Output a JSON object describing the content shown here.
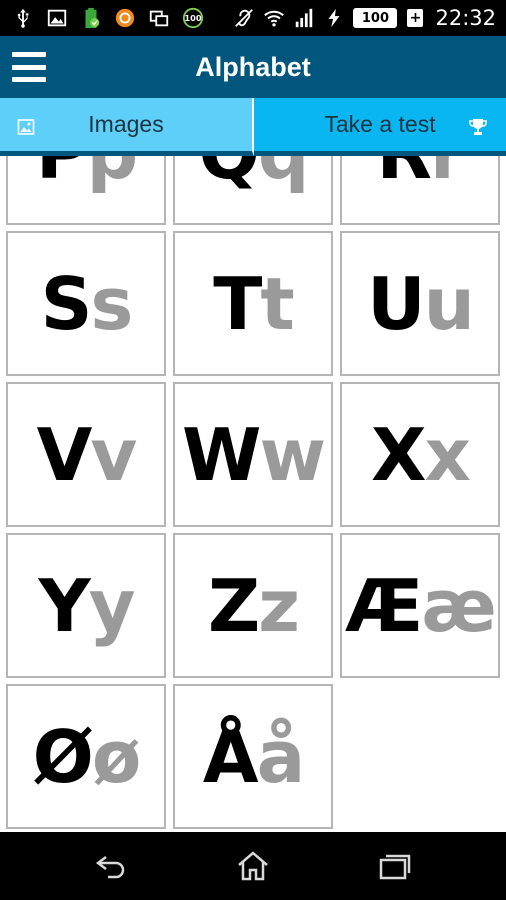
{
  "status_bar": {
    "battery_level": "100",
    "battery_plus": "+",
    "clock": "22:32",
    "left_icons": [
      "usb-icon",
      "image-icon",
      "battery-app-icon",
      "app-icon",
      "window-icon",
      "badge-100-icon"
    ],
    "right_icons": [
      "hearing-icon",
      "wifi-icon",
      "signal-icon",
      "charging-icon"
    ]
  },
  "app_bar": {
    "title": "Alphabet",
    "color": "#00567d"
  },
  "tabs": [
    {
      "label": "Images",
      "icon": "image-icon",
      "selected": true
    },
    {
      "label": "Take a test",
      "icon": "trophy-icon",
      "selected": false
    }
  ],
  "letters": [
    {
      "upper": "P",
      "lower": "p"
    },
    {
      "upper": "Q",
      "lower": "q"
    },
    {
      "upper": "R",
      "lower": "r"
    },
    {
      "upper": "S",
      "lower": "s"
    },
    {
      "upper": "T",
      "lower": "t"
    },
    {
      "upper": "U",
      "lower": "u"
    },
    {
      "upper": "V",
      "lower": "v"
    },
    {
      "upper": "W",
      "lower": "w"
    },
    {
      "upper": "X",
      "lower": "x"
    },
    {
      "upper": "Y",
      "lower": "y"
    },
    {
      "upper": "Z",
      "lower": "z"
    },
    {
      "upper": "Æ",
      "lower": "æ"
    },
    {
      "upper": "Ø",
      "lower": "ø"
    },
    {
      "upper": "Å",
      "lower": "å"
    }
  ],
  "nav_bar": {
    "buttons": [
      "back-icon",
      "home-icon",
      "recent-apps-icon"
    ]
  }
}
